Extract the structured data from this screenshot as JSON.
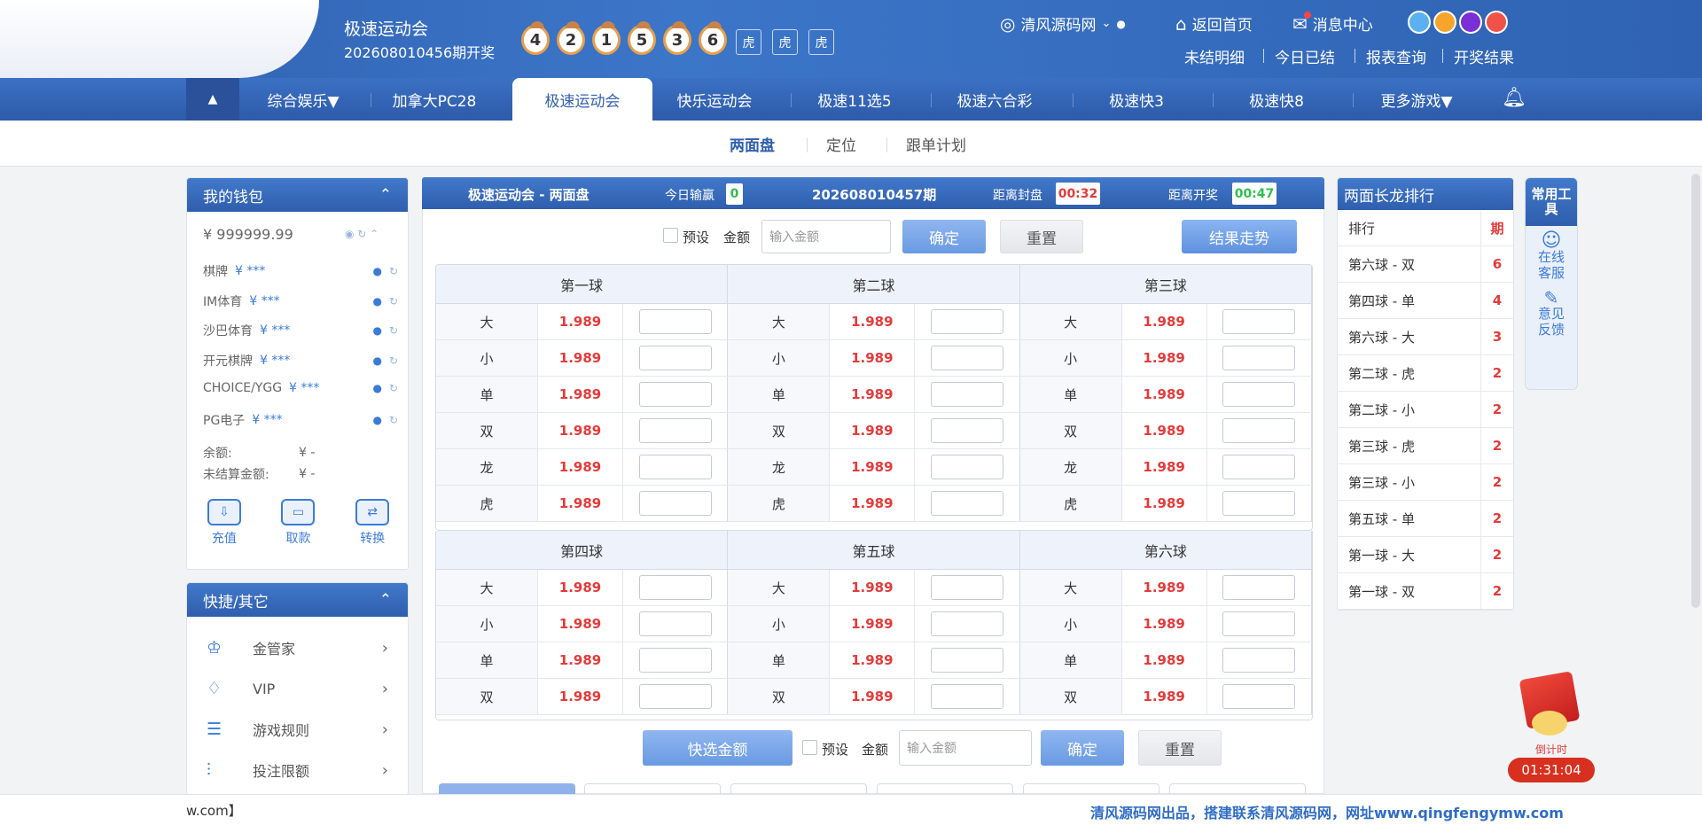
{
  "header": {
    "game_title": "极速运动会",
    "issue_open": "202608010456期开奖",
    "balls": [
      "4",
      "2",
      "1",
      "5",
      "3",
      "6"
    ],
    "tags": [
      "虎",
      "虎",
      "虎"
    ],
    "user": "清风源码网",
    "home": "返回首页",
    "messages": "消息中心",
    "links": [
      "未结明细",
      "今日已结",
      "报表查询",
      "开奖结果"
    ],
    "color_dots": [
      "#5ab0f0",
      "#f5a52b",
      "#7b2fd6",
      "#f0524a"
    ]
  },
  "nav": {
    "items": [
      "综合娱乐▼",
      "加拿大PC28",
      "极速运动会",
      "快乐运动会",
      "极速11选5",
      "极速六合彩",
      "极速快3",
      "极速快8",
      "更多游戏▼"
    ],
    "active": "极速运动会"
  },
  "subnav": {
    "items": [
      "两面盘",
      "定位",
      "跟单计划"
    ]
  },
  "wallet": {
    "title": "我的钱包",
    "balance": "¥ 999999.99",
    "platforms": [
      {
        "name": "棋牌",
        "value": "¥ ***"
      },
      {
        "name": "IM体育",
        "value": "¥ ***"
      },
      {
        "name": "沙巴体育",
        "value": "¥ ***"
      },
      {
        "name": "开元棋牌",
        "value": "¥ ***"
      },
      {
        "name": "CHOICE/YGG",
        "value": "¥ ***"
      },
      {
        "name": "PG电子",
        "value": "¥ ***"
      }
    ],
    "remain_label": "余额:",
    "remain_value": "¥ -",
    "unsettled_label": "未结算金额:",
    "unsettled_value": "¥ -",
    "actions": [
      "充值",
      "取款",
      "转换"
    ]
  },
  "quick": {
    "title": "快捷/其它",
    "items": [
      "金管家",
      "VIP",
      "游戏规则",
      "投注限额"
    ]
  },
  "main": {
    "title": "极速运动会 - 两面盘",
    "today_label": "今日输赢",
    "today_value": "0",
    "issue": "202608010457期",
    "close_label": "距离封盘",
    "close_time": "00:32",
    "draw_label": "距离开奖",
    "draw_time": "00:47",
    "preset": "预设",
    "amount": "金额",
    "amount_placeholder": "输入金额",
    "confirm": "确定",
    "reset": "重置",
    "trend": "结果走势",
    "quick_amount": "快选金额",
    "balls_top": [
      "第一球",
      "第二球",
      "第三球"
    ],
    "balls_bottom": [
      "第四球",
      "第五球",
      "第六球"
    ],
    "options_top": [
      "大",
      "小",
      "单",
      "双",
      "龙",
      "虎"
    ],
    "options_bottom": [
      "大",
      "小",
      "单",
      "双"
    ],
    "odds": "1.989"
  },
  "rank": {
    "title": "两面长龙排行",
    "col_name": "排行",
    "col_val": "期",
    "rows": [
      {
        "name": "第六球 - 双",
        "value": "6"
      },
      {
        "name": "第四球 - 单",
        "value": "4"
      },
      {
        "name": "第六球 - 大",
        "value": "3"
      },
      {
        "name": "第二球 - 虎",
        "value": "2"
      },
      {
        "name": "第二球 - 小",
        "value": "2"
      },
      {
        "name": "第三球 - 虎",
        "value": "2"
      },
      {
        "name": "第三球 - 小",
        "value": "2"
      },
      {
        "name": "第五球 - 单",
        "value": "2"
      },
      {
        "name": "第一球 - 大",
        "value": "2"
      },
      {
        "name": "第一球 - 双",
        "value": "2"
      }
    ]
  },
  "tools": {
    "title": "常用工具",
    "service": "在线客服",
    "feedback": "意见反馈"
  },
  "promo": {
    "label": "倒计时",
    "time": "01:31:04"
  },
  "footer": {
    "left": "w.com】",
    "right": "清风源码网出品，搭建联系清风源码网，网址www.qingfengymw.com"
  }
}
